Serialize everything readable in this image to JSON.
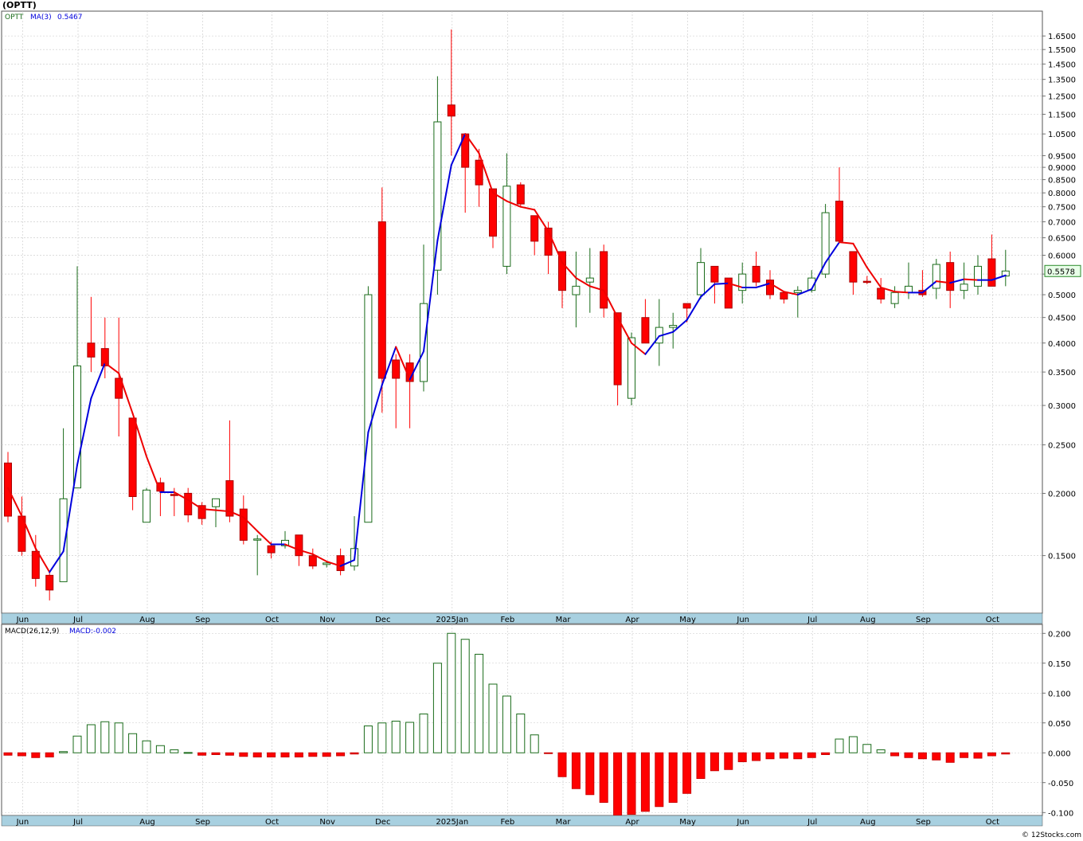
{
  "header": {
    "title": "(OPTT)",
    "credit": "© 12Stocks.com"
  },
  "price_panel": {
    "symbol": "OPTT",
    "ma_label": "MA(3)",
    "ma_value": "0.5467",
    "last_price": "0.5578"
  },
  "macd_panel": {
    "label": "MACD(26,12,9)",
    "value_label": "MACD:-0.002"
  },
  "colors": {
    "up": "#1a6b1a",
    "down": "#ff0000",
    "ma_up": "#0000dd",
    "ma_down": "#ee0000",
    "grid": "#c8c8c8",
    "axis_band": "#a8d0e0",
    "tag_bg": "#e8ffe8",
    "tag_border": "#2a8a2a"
  },
  "chart_data": [
    {
      "type": "candlestick",
      "title": "(OPTT)",
      "scale": "log",
      "ylim": [
        0.115,
        1.85
      ],
      "y_ticks": [
        0.15,
        0.2,
        0.25,
        0.3,
        0.35,
        0.4,
        0.45,
        0.5,
        0.55,
        0.6,
        0.65,
        0.7,
        0.75,
        0.8,
        0.85,
        0.9,
        0.95,
        1.05,
        1.15,
        1.25,
        1.35,
        1.45,
        1.55,
        1.65
      ],
      "y_tick_labels": [
        "0.1500",
        "0.2000",
        "0.2500",
        "0.3000",
        "0.3500",
        "0.4000",
        "0.4500",
        "0.5000",
        "",
        "0.6000",
        "0.6500",
        "0.7000",
        "0.7500",
        "0.8000",
        "0.8500",
        "0.9000",
        "0.9500",
        "1.0500",
        "1.1500",
        "1.2500",
        "1.3500",
        "1.4500",
        "1.5500",
        "1.6500"
      ],
      "month_labels": [
        "Jun",
        "Jul",
        "Aug",
        "Sep",
        "Oct",
        "Nov",
        "Dec",
        "2025Jan",
        "Feb",
        "Mar",
        "Apr",
        "May",
        "Jun",
        "Jul",
        "Aug",
        "Sep",
        "Oct"
      ],
      "month_tick_index": [
        1,
        5,
        10,
        14,
        19,
        23,
        27,
        32,
        36,
        40,
        45,
        49,
        53,
        58,
        62,
        66,
        71
      ],
      "grid": true,
      "candles": [
        [
          0.23,
          0.242,
          0.175,
          0.18
        ],
        [
          0.18,
          0.197,
          0.15,
          0.153
        ],
        [
          0.153,
          0.165,
          0.13,
          0.135
        ],
        [
          0.137,
          0.14,
          0.122,
          0.128
        ],
        [
          0.133,
          0.27,
          0.133,
          0.195
        ],
        [
          0.205,
          0.57,
          0.205,
          0.36
        ],
        [
          0.4,
          0.495,
          0.35,
          0.375
        ],
        [
          0.39,
          0.45,
          0.34,
          0.36
        ],
        [
          0.34,
          0.45,
          0.26,
          0.31
        ],
        [
          0.283,
          0.283,
          0.185,
          0.197
        ],
        [
          0.175,
          0.205,
          0.175,
          0.203
        ],
        [
          0.21,
          0.215,
          0.18,
          0.202
        ],
        [
          0.199,
          0.205,
          0.18,
          0.198
        ],
        [
          0.2,
          0.205,
          0.175,
          0.181
        ],
        [
          0.189,
          0.192,
          0.173,
          0.178
        ],
        [
          0.188,
          0.195,
          0.171,
          0.195
        ],
        [
          0.212,
          0.28,
          0.175,
          0.18
        ],
        [
          0.186,
          0.198,
          0.158,
          0.161
        ],
        [
          0.162,
          0.165,
          0.137,
          0.162
        ],
        [
          0.157,
          0.16,
          0.148,
          0.152
        ],
        [
          0.157,
          0.168,
          0.155,
          0.161
        ],
        [
          0.165,
          0.165,
          0.143,
          0.15
        ],
        [
          0.15,
          0.155,
          0.141,
          0.143
        ],
        [
          0.144,
          0.146,
          0.142,
          0.145
        ],
        [
          0.15,
          0.155,
          0.137,
          0.14
        ],
        [
          0.143,
          0.18,
          0.14,
          0.155
        ],
        [
          0.175,
          0.52,
          0.175,
          0.5
        ],
        [
          0.7,
          0.82,
          0.29,
          0.34
        ],
        [
          0.37,
          0.38,
          0.27,
          0.34
        ],
        [
          0.365,
          0.38,
          0.27,
          0.335
        ],
        [
          0.335,
          0.63,
          0.32,
          0.48
        ],
        [
          0.56,
          1.37,
          0.5,
          1.11
        ],
        [
          1.2,
          1.7,
          0.95,
          1.14
        ],
        [
          1.05,
          1.05,
          0.73,
          0.9
        ],
        [
          0.93,
          0.98,
          0.75,
          0.83
        ],
        [
          0.815,
          0.815,
          0.62,
          0.655
        ],
        [
          0.57,
          0.96,
          0.55,
          0.825
        ],
        [
          0.83,
          0.84,
          0.75,
          0.76
        ],
        [
          0.72,
          0.72,
          0.6,
          0.64
        ],
        [
          0.68,
          0.7,
          0.55,
          0.6
        ],
        [
          0.61,
          0.61,
          0.47,
          0.51
        ],
        [
          0.5,
          0.61,
          0.43,
          0.52
        ],
        [
          0.53,
          0.62,
          0.46,
          0.54
        ],
        [
          0.61,
          0.63,
          0.45,
          0.47
        ],
        [
          0.46,
          0.46,
          0.3,
          0.33
        ],
        [
          0.31,
          0.42,
          0.3,
          0.41
        ],
        [
          0.45,
          0.49,
          0.4,
          0.4
        ],
        [
          0.4,
          0.49,
          0.36,
          0.43
        ],
        [
          0.43,
          0.46,
          0.39,
          0.434
        ],
        [
          0.48,
          0.48,
          0.44,
          0.47
        ],
        [
          0.5,
          0.62,
          0.49,
          0.58
        ],
        [
          0.57,
          0.57,
          0.48,
          0.53
        ],
        [
          0.54,
          0.54,
          0.47,
          0.47
        ],
        [
          0.51,
          0.58,
          0.48,
          0.55
        ],
        [
          0.57,
          0.61,
          0.52,
          0.53
        ],
        [
          0.535,
          0.56,
          0.49,
          0.5
        ],
        [
          0.505,
          0.5,
          0.48,
          0.49
        ],
        [
          0.505,
          0.52,
          0.45,
          0.51
        ],
        [
          0.51,
          0.56,
          0.505,
          0.54
        ],
        [
          0.55,
          0.76,
          0.54,
          0.73
        ],
        [
          0.77,
          0.9,
          0.64,
          0.64
        ],
        [
          0.61,
          0.61,
          0.5,
          0.53
        ],
        [
          0.532,
          0.545,
          0.525,
          0.53
        ],
        [
          0.515,
          0.54,
          0.48,
          0.49
        ],
        [
          0.48,
          0.52,
          0.47,
          0.505
        ],
        [
          0.505,
          0.58,
          0.49,
          0.52
        ],
        [
          0.51,
          0.56,
          0.495,
          0.5
        ],
        [
          0.515,
          0.59,
          0.49,
          0.575
        ],
        [
          0.58,
          0.61,
          0.47,
          0.51
        ],
        [
          0.51,
          0.58,
          0.49,
          0.525
        ],
        [
          0.52,
          0.6,
          0.5,
          0.57
        ],
        [
          0.59,
          0.66,
          0.52,
          0.52
        ],
        [
          0.545,
          0.615,
          0.52,
          0.5578
        ]
      ],
      "ma3": [
        0.205,
        0.18,
        0.155,
        0.139,
        0.153,
        0.228,
        0.31,
        0.365,
        0.348,
        0.289,
        0.237,
        0.201,
        0.201,
        0.194,
        0.186,
        0.185,
        0.184,
        0.179,
        0.168,
        0.158,
        0.158,
        0.154,
        0.151,
        0.146,
        0.143,
        0.147,
        0.265,
        0.33,
        0.393,
        0.338,
        0.385,
        0.642,
        0.91,
        1.05,
        0.96,
        0.8,
        0.77,
        0.75,
        0.74,
        0.67,
        0.58,
        0.54,
        0.52,
        0.51,
        0.45,
        0.4,
        0.38,
        0.413,
        0.421,
        0.445,
        0.495,
        0.525,
        0.527,
        0.517,
        0.517,
        0.527,
        0.507,
        0.5,
        0.513,
        0.58,
        0.637,
        0.633,
        0.567,
        0.517,
        0.507,
        0.505,
        0.505,
        0.532,
        0.528,
        0.537,
        0.535,
        0.535,
        0.5467
      ]
    },
    {
      "type": "bar",
      "title": "MACD(26,12,9)",
      "ylim": [
        -0.105,
        0.215
      ],
      "y_ticks": [
        -0.1,
        -0.05,
        0.0,
        0.05,
        0.1,
        0.15,
        0.2
      ],
      "y_tick_labels": [
        "-0.100",
        "-0.050",
        "0.000",
        "0.050",
        "0.100",
        "0.150",
        "0.200"
      ],
      "month_labels": [
        "Jun",
        "Jul",
        "Aug",
        "Sep",
        "Oct",
        "Nov",
        "Dec",
        "2025Jan",
        "Feb",
        "Mar",
        "Apr",
        "May",
        "Jun",
        "Jul",
        "Aug",
        "Sep",
        "Oct"
      ],
      "values": [
        -0.004,
        -0.005,
        -0.008,
        -0.007,
        0.002,
        0.028,
        0.047,
        0.052,
        0.05,
        0.032,
        0.02,
        0.012,
        0.005,
        0.0005,
        -0.004,
        -0.003,
        -0.004,
        -0.006,
        -0.007,
        -0.007,
        -0.007,
        -0.007,
        -0.006,
        -0.006,
        -0.005,
        -0.002,
        0.045,
        0.05,
        0.053,
        0.051,
        0.065,
        0.15,
        0.2,
        0.19,
        0.165,
        0.115,
        0.095,
        0.065,
        0.03,
        -0.001,
        -0.04,
        -0.06,
        -0.07,
        -0.083,
        -0.105,
        -0.103,
        -0.098,
        -0.09,
        -0.083,
        -0.068,
        -0.043,
        -0.03,
        -0.028,
        -0.015,
        -0.013,
        -0.01,
        -0.009,
        -0.01,
        -0.008,
        -0.003,
        0.023,
        0.027,
        0.014,
        0.005,
        -0.005,
        -0.008,
        -0.01,
        -0.012,
        -0.016,
        -0.008,
        -0.009,
        -0.005,
        -0.002
      ]
    }
  ]
}
